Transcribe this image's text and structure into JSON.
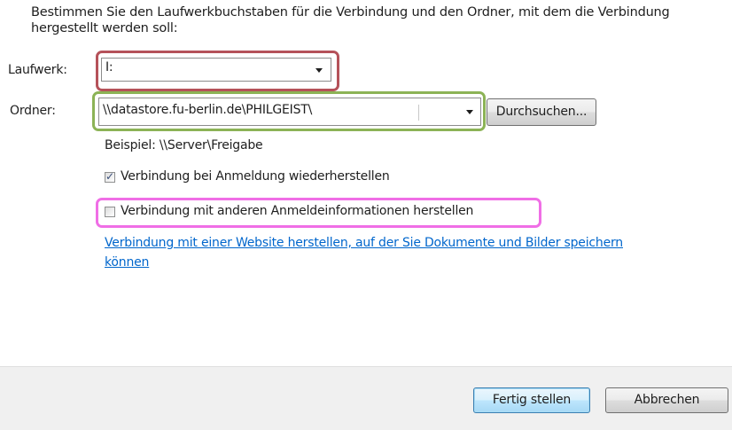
{
  "instructions": {
    "line1": "Bestimmen Sie den Laufwerkbuchstaben für die Verbindung und den Ordner, mit dem die Verbindung",
    "line2": "hergestellt werden soll:"
  },
  "drive": {
    "label": "Laufwerk:",
    "value": "I:"
  },
  "folder": {
    "label": "Ordner:",
    "value": "\\\\datastore.fu-berlin.de\\PHILGEIST\\",
    "browse_label": "Durchsuchen..."
  },
  "example_text": "Beispiel: \\\\Server\\Freigabe",
  "options": {
    "reconnect": {
      "label": "Verbindung bei Anmeldung wiederherstellen",
      "checked": true
    },
    "other_credentials": {
      "label": "Verbindung mit anderen Anmeldeinformationen herstellen",
      "checked": false
    }
  },
  "website_link": {
    "line1": "Verbindung mit einer Website herstellen, auf der Sie Dokumente und Bilder speichern",
    "line2": "können"
  },
  "buttons": {
    "finish_label": "Fertig stellen",
    "cancel_label": "Abbrechen"
  },
  "colors": {
    "highlight_drive": "#b5525a",
    "highlight_folder": "#8cb356",
    "highlight_credentials": "#f06ee6",
    "link": "#0066cc"
  }
}
